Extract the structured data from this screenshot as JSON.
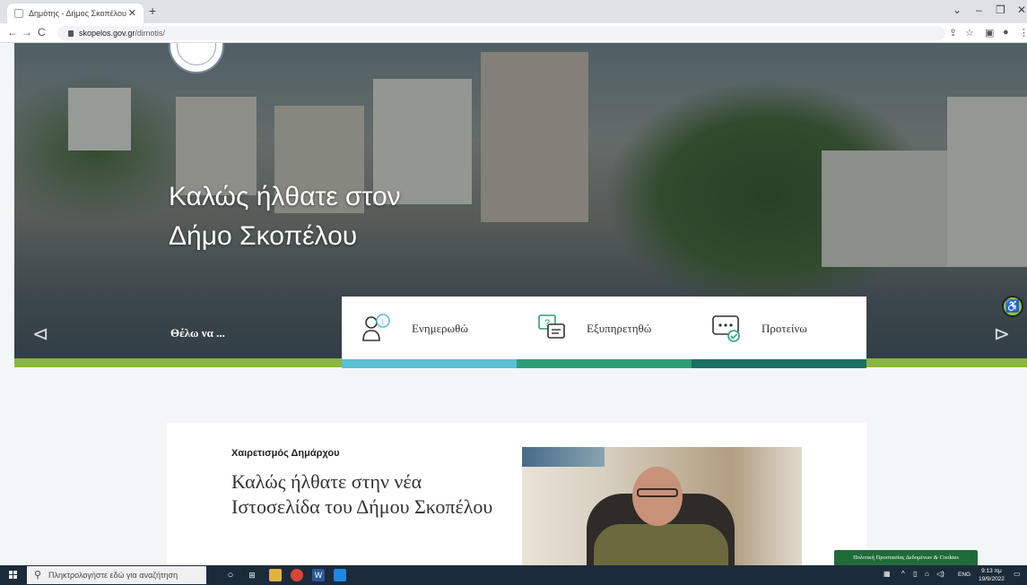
{
  "browser": {
    "tab_title": "Δημότης - Δήμος Σκοπέλου",
    "url_host": "skopelos.gov.gr",
    "url_path": "/dimotis/"
  },
  "hero": {
    "title_line1": "Καλώς ήλθατε στον",
    "title_line2": "Δήμο Σκοπέλου",
    "want_label": "Θέλω να ..."
  },
  "cards": [
    {
      "label": "Ενημερωθώ",
      "color": "#5bbfd3"
    },
    {
      "label": "Εξυπηρετηθώ",
      "color": "#2f9e77"
    },
    {
      "label": "Προτείνω",
      "color": "#1d6e63"
    }
  ],
  "welcome": {
    "subtitle": "Χαιρετισμός Δημάρχου",
    "heading": "Καλώς ήλθατε στην νέα Ιστοσελίδα του Δήμου Σκοπέλου"
  },
  "cookie_label": "Πολιτική Προστασίας Δεδομένων & Cookies",
  "taskbar": {
    "search_placeholder": "Πληκτρολογήστε εδώ για αναζήτηση",
    "lang": "ENG",
    "time": "9:13 πμ",
    "date": "19/9/2022"
  }
}
